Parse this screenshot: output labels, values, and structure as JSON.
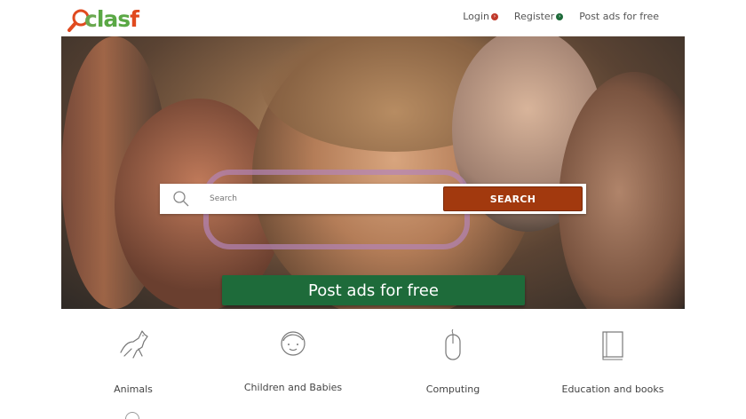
{
  "logo": {
    "part1": "c",
    "part2": "las",
    "part3": "f"
  },
  "nav": {
    "login": "Login",
    "register": "Register",
    "post_ads": "Post ads for free"
  },
  "search": {
    "placeholder": "Search",
    "button": "SEARCH"
  },
  "hero": {
    "post_button": "Post ads for free"
  },
  "categories": [
    {
      "label": "Animals",
      "icon": "dog-icon"
    },
    {
      "label": "Children and Babies",
      "icon": "baby-face-icon"
    },
    {
      "label": "Computing",
      "icon": "mouse-icon"
    },
    {
      "label": "Education and books",
      "icon": "book-icon"
    }
  ],
  "colors": {
    "search_button": "#a2390e",
    "post_button": "#1e6b3a",
    "login_badge": "#c0392b",
    "register_badge": "#1e6b3a"
  }
}
